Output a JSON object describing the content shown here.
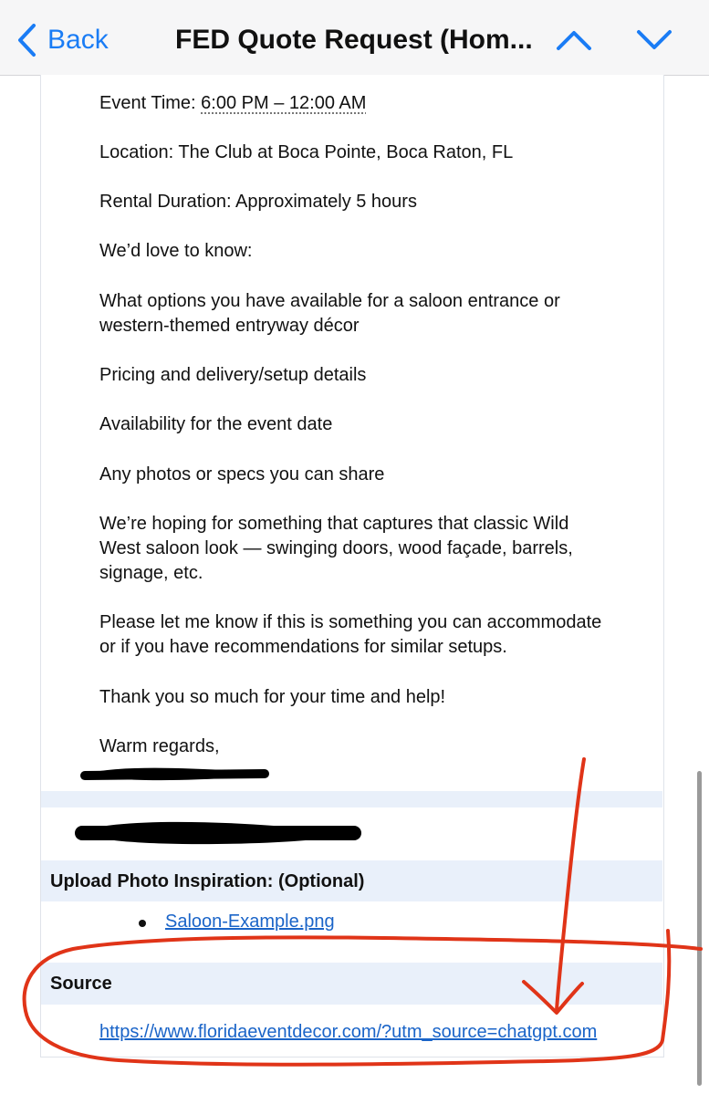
{
  "nav": {
    "back_label": "Back",
    "title": "FED Quote Request (Hom..."
  },
  "email": {
    "event_time_label": "Event Time:",
    "event_time_value": "6:00 PM – 12:00 AM",
    "location": "Location: The Club at Boca Pointe, Boca Raton, FL",
    "rental_duration": "Rental Duration: Approximately 5 hours",
    "love_to_know": "We’d love to know:",
    "option_line1": "What options you have available for a saloon entrance or",
    "option_line2": "western-themed entryway décor",
    "pricing": "Pricing and delivery/setup details",
    "availability": "Availability for the event date",
    "photos": "Any photos or specs you can share",
    "hoping_line1": "We’re hoping for something that captures that classic Wild",
    "hoping_line2": "West saloon look — swinging doors, wood façade, barrels,",
    "hoping_line3": "signage, etc.",
    "please_line1": "Please let me know if this is something you can accommodate",
    "please_line2": "or if you have recommendations for similar setups.",
    "thanks": "Thank you so much for your time and help!",
    "closing": "Warm regards,"
  },
  "form": {
    "upload_label": "Upload Photo Inspiration: (Optional)",
    "attachment": "Saloon-Example.png",
    "source_label": "Source",
    "source_url": "https://www.floridaeventdecor.com/?utm_source=chatgpt.com"
  },
  "colors": {
    "accent": "#1a7cf5",
    "link": "#1a64c8",
    "band": "#e9f0fa",
    "annotation": "#e03418",
    "redaction": "#000000"
  },
  "icons": [
    "chevron-left-icon",
    "chevron-up-icon",
    "chevron-down-icon"
  ]
}
